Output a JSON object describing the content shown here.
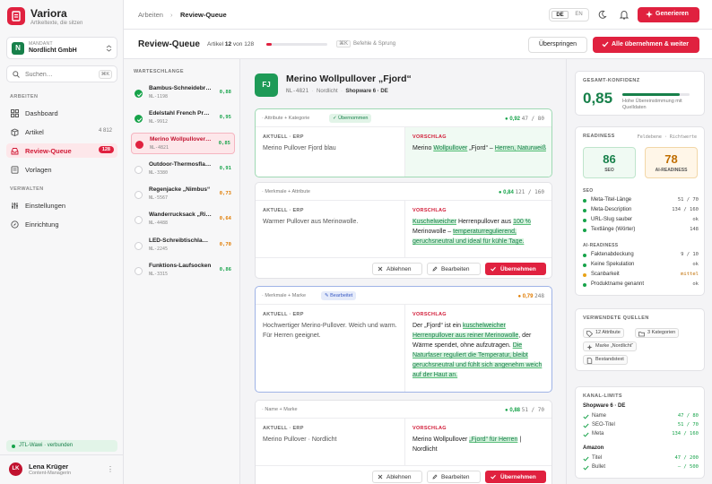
{
  "app": {
    "name": "Variora",
    "tagline": "Artikeltexte, die sitzen"
  },
  "mandant": {
    "label": "MANDANT",
    "name": "Nordlicht GmbH",
    "initial": "N"
  },
  "search": {
    "placeholder": "Suchen…",
    "shortcut": "⌘K"
  },
  "nav": {
    "section_work": "ARBEITEN",
    "items": [
      {
        "label": "Dashboard",
        "icon": "grid-icon"
      },
      {
        "label": "Artikel",
        "count": "4 812",
        "icon": "box-icon"
      },
      {
        "label": "Review-Queue",
        "badge": "128",
        "icon": "inbox-icon"
      },
      {
        "label": "Vorlagen",
        "icon": "template-icon"
      }
    ],
    "section_admin": "VERWALTEN",
    "admin_items": [
      {
        "label": "Einstellungen",
        "icon": "sliders-icon"
      },
      {
        "label": "Einrichtung",
        "icon": "compass-icon"
      }
    ]
  },
  "connection": "JTL-Wawi · verbunden",
  "user": {
    "initials": "LK",
    "name": "Lena Krüger",
    "role": "Content-Managerin"
  },
  "topbar": {
    "breadcrumb_root": "Arbeiten",
    "breadcrumb_current": "Review-Queue",
    "lang_active": "DE",
    "lang_other": "EN",
    "generate_label": "Generieren"
  },
  "review": {
    "title": "Review-Queue",
    "progress_prefix": "Artikel",
    "progress_current": "12",
    "progress_mid": "von",
    "progress_total": "128",
    "progress_fraction": 0.094,
    "shortcut_key": "⌘K",
    "shortcut_label": "Befehle & Sprung",
    "skip_label": "Überspringen",
    "accept_all_label": "Alle übernehmen & weiter"
  },
  "queue": {
    "title": "WARTESCHLANGE",
    "items": [
      {
        "name": "Bambus-Schneidebrett",
        "sku": "NL-1198",
        "score": "0,88",
        "status": "done",
        "tone": "g"
      },
      {
        "name": "Edelstahl French Press",
        "sku": "NL-9912",
        "score": "0,95",
        "status": "done",
        "tone": "g"
      },
      {
        "name": "Merino Wollpullover „Fjord“",
        "sku": "NL-4821",
        "score": "0,85",
        "status": "current",
        "tone": "g"
      },
      {
        "name": "Outdoor-Thermosflasche",
        "sku": "NL-3380",
        "score": "0,91",
        "status": "open",
        "tone": "g"
      },
      {
        "name": "Regenjacke „Nimbus“",
        "sku": "NL-5567",
        "score": "0,73",
        "status": "open",
        "tone": "o"
      },
      {
        "name": "Wanderrucksack „Ridge“",
        "sku": "NL-4488",
        "score": "0,64",
        "status": "open",
        "tone": "o"
      },
      {
        "name": "LED-Schreibtischlampe",
        "sku": "NL-2245",
        "score": "0,70",
        "status": "open",
        "tone": "o"
      },
      {
        "name": "Funktions-Laufsocken",
        "sku": "NL-3315",
        "score": "0,86",
        "status": "open",
        "tone": "g"
      }
    ]
  },
  "product": {
    "badge": "FJ",
    "title": "Merino Wollpullover „Fjord“",
    "sku": "NL-4821",
    "brand": "Nordlicht",
    "channel": "Shopware 6 · DE"
  },
  "labels": {
    "current": "AKTUELL · ERP",
    "suggestion": "VORSCHLAG",
    "reject": "Ablehnen",
    "edit": "Bearbeiten",
    "accept": "Übernehmen"
  },
  "cards": [
    {
      "tags": "· Attribute + Kategorie",
      "status": "Übernommen",
      "score": "0,92",
      "length": "47 / 80",
      "current": "Merino Pullover Fjord blau",
      "segments": [
        [
          "Merino ",
          false
        ],
        [
          "Wollpullover",
          true
        ],
        [
          " „Fjord“ – ",
          false
        ],
        [
          "Herren, Naturweiß",
          true
        ]
      ]
    },
    {
      "tags": "· Merkmale + Attribute",
      "score": "0,84",
      "length": "121 / 160",
      "current": "Warmer Pullover aus Merinowolle.",
      "segments": [
        [
          "Kuschelweicher",
          true
        ],
        [
          " Herrenpullover aus ",
          false
        ],
        [
          "100 %",
          true
        ],
        [
          " Merinowolle – ",
          false
        ],
        [
          "temperaturregulierend, geruchsneutral und ideal für kühle Tage.",
          true
        ]
      ]
    },
    {
      "tags": "· Merkmale + Marke",
      "status": "Bearbeitet",
      "score": "0,79",
      "length": "248",
      "current": "Hochwertiger Merino-Pullover. Weich und warm. Für Herren geeignet.",
      "segments": [
        [
          "Der „Fjord“ ist ein ",
          false
        ],
        [
          "kuschelweicher Herrenpullover aus reiner Merinowolle",
          true
        ],
        [
          ", der Wärme spendet, ohne aufzutragen. ",
          false
        ],
        [
          "Die Naturfaser reguliert die Temperatur, bleibt geruchsneutral und fühlt sich angenehm weich auf der Haut an.",
          true
        ]
      ]
    },
    {
      "tags": "· Name + Marke",
      "score": "0,88",
      "length": "51 / 70",
      "current": "Merino Pullover · Nordlicht",
      "segments": [
        [
          "Merino Wollpullover ",
          false
        ],
        [
          "„Fjord“ für Herren",
          true
        ],
        [
          " | Nordlicht",
          false
        ]
      ]
    }
  ],
  "confidence": {
    "title": "GESAMT-KONFIDENZ",
    "value": "0,85",
    "fraction": 0.85,
    "description": "Hohe Übereinstimmung mit Quelldaten"
  },
  "readiness": {
    "title": "READINESS",
    "mode": "Feldebene · Richtwerte",
    "seo_score": "86",
    "seo_label": "SEO",
    "ai_score": "78",
    "ai_label": "AI-READINESS",
    "seo_head": "SEO",
    "seo_rows": [
      {
        "name": "Meta-Titel-Länge",
        "value": "51 / 70",
        "tone": "g"
      },
      {
        "name": "Meta-Description",
        "value": "134 / 160",
        "tone": "g"
      },
      {
        "name": "URL-Slug sauber",
        "value": "ok",
        "tone": "g"
      },
      {
        "name": "Textlänge (Wörter)",
        "value": "148",
        "tone": "g"
      }
    ],
    "ai_head": "AI-READINESS",
    "ai_rows": [
      {
        "name": "Faktenabdeckung",
        "value": "9 / 10",
        "tone": "g"
      },
      {
        "name": "Keine Spekulation",
        "value": "ok",
        "tone": "g"
      },
      {
        "name": "Scanbarkeit",
        "value": "mittel",
        "tone": "y"
      },
      {
        "name": "Produktname genannt",
        "value": "ok",
        "tone": "g"
      }
    ]
  },
  "sources": {
    "title": "VERWENDETE QUELLEN",
    "chips": [
      "12 Attribute",
      "3 Kategorien",
      "Marke „Nordlicht“",
      "Bestandstext"
    ]
  },
  "limits": {
    "title": "KANAL-LIMITS",
    "groups": [
      {
        "name": "Shopware 6 · DE",
        "rows": [
          {
            "name": "Name",
            "value": "47 / 80"
          },
          {
            "name": "SEO-Titel",
            "value": "51 / 70"
          },
          {
            "name": "Meta",
            "value": "134 / 160"
          }
        ]
      },
      {
        "name": "Amazon",
        "rows": [
          {
            "name": "Titel",
            "value": "47 / 200"
          },
          {
            "name": "Bullet",
            "value": "– / 500"
          }
        ]
      }
    ]
  },
  "colors": {
    "accent": "#e0213f",
    "success": "#17a34a",
    "warning": "#e07b00"
  }
}
